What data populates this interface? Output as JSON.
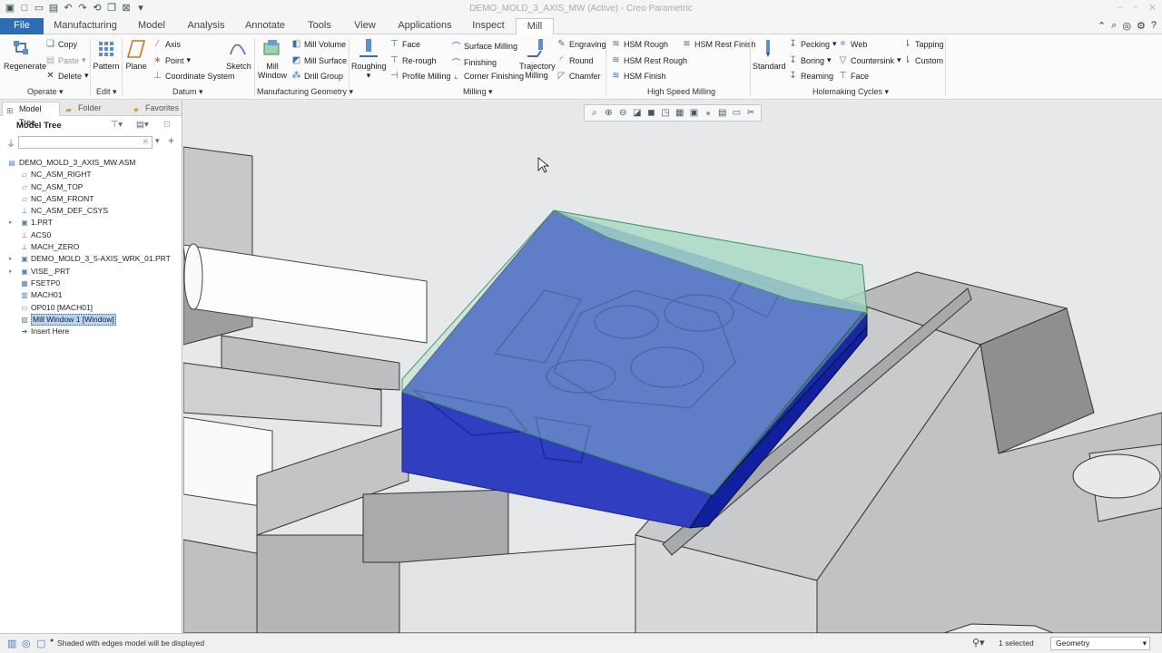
{
  "window": {
    "title": "DEMO_MOLD_3_AXIS_MW (Active) - Creo Parametric"
  },
  "tabs": [
    "File",
    "Manufacturing",
    "Model",
    "Analysis",
    "Annotate",
    "Tools",
    "View",
    "Applications",
    "Inspect",
    "Mill"
  ],
  "active_tab": "Mill",
  "ribbon": {
    "operate": {
      "regenerate": "Regenerate",
      "copy": "Copy",
      "paste": "Paste",
      "delete": "Delete",
      "group": "Operate"
    },
    "edit": {
      "pattern": "Pattern",
      "group": "Edit"
    },
    "datum": {
      "plane": "Plane",
      "axis": "Axis",
      "point": "Point",
      "csys": "Coordinate System",
      "sketch": "Sketch",
      "group": "Datum"
    },
    "mfg_geom": {
      "mill_window": "Mill\nWindow",
      "mill_volume": "Mill Volume",
      "mill_surface": "Mill Surface",
      "drill_group": "Drill Group",
      "group": "Manufacturing Geometry"
    },
    "milling": {
      "roughing": "Roughing",
      "face": "Face",
      "rerough": "Re-rough",
      "profile": "Profile Milling",
      "surface": "Surface Milling",
      "finishing": "Finishing",
      "corner": "Corner Finishing",
      "trajectory": "Trajectory\nMilling",
      "engraving": "Engraving",
      "round": "Round",
      "chamfer": "Chamfer",
      "group": "Milling"
    },
    "hsm": {
      "rough": "HSM Rough",
      "rest_rough": "HSM Rest Rough",
      "finish": "HSM Finish",
      "rest_finish": "HSM Rest Finish",
      "group": "High Speed Milling"
    },
    "holes": {
      "standard": "Standard",
      "pecking": "Pecking",
      "boring": "Boring",
      "reaming": "Reaming",
      "web": "Web",
      "countersink": "Countersink",
      "face": "Face",
      "tapping": "Tapping",
      "custom": "Custom",
      "group": "Holemaking Cycles"
    }
  },
  "panel": {
    "tabs": [
      "Model Tree",
      "Folder Browser",
      "Favorites"
    ],
    "header": "Model Tree",
    "tree": [
      {
        "label": "DEMO_MOLD_3_AXIS_MW.ASM",
        "level": 0,
        "expand": false,
        "icon": "assembly"
      },
      {
        "label": "NC_ASM_RIGHT",
        "level": 1,
        "expand": false,
        "icon": "plane"
      },
      {
        "label": "NC_ASM_TOP",
        "level": 1,
        "expand": false,
        "icon": "plane"
      },
      {
        "label": "NC_ASM_FRONT",
        "level": 1,
        "expand": false,
        "icon": "plane"
      },
      {
        "label": "NC_ASM_DEF_CSYS",
        "level": 1,
        "expand": false,
        "icon": "csys"
      },
      {
        "label": "1.PRT",
        "level": 1,
        "expand": true,
        "icon": "part"
      },
      {
        "label": "ACS0",
        "level": 1,
        "expand": false,
        "icon": "csys"
      },
      {
        "label": "MACH_ZERO",
        "level": 1,
        "expand": false,
        "icon": "csys"
      },
      {
        "label": "DEMO_MOLD_3_5-AXIS_WRK_01.PRT",
        "level": 1,
        "expand": true,
        "icon": "part"
      },
      {
        "label": "VISE_.PRT",
        "level": 1,
        "expand": true,
        "icon": "part"
      },
      {
        "label": "FSETP0",
        "level": 1,
        "expand": false,
        "icon": "fixture"
      },
      {
        "label": "MACH01",
        "level": 1,
        "expand": false,
        "icon": "machine"
      },
      {
        "label": "OP010 [MACH01]",
        "level": 1,
        "expand": false,
        "icon": "operation"
      },
      {
        "label": "Mill Window 1 [Window]",
        "level": 1,
        "expand": false,
        "icon": "window",
        "selected": true
      },
      {
        "label": "Insert Here",
        "level": 1,
        "expand": false,
        "icon": "insert"
      }
    ]
  },
  "status": {
    "message": "Shaded with edges model will be displayed",
    "selection": "1 selected",
    "filter": "Geometry"
  },
  "colors": {
    "accent": "#2e6db4",
    "part_blue": "#3346c8",
    "window_green": "#8fd0b0",
    "vise_gray": "#c4c5c7"
  }
}
